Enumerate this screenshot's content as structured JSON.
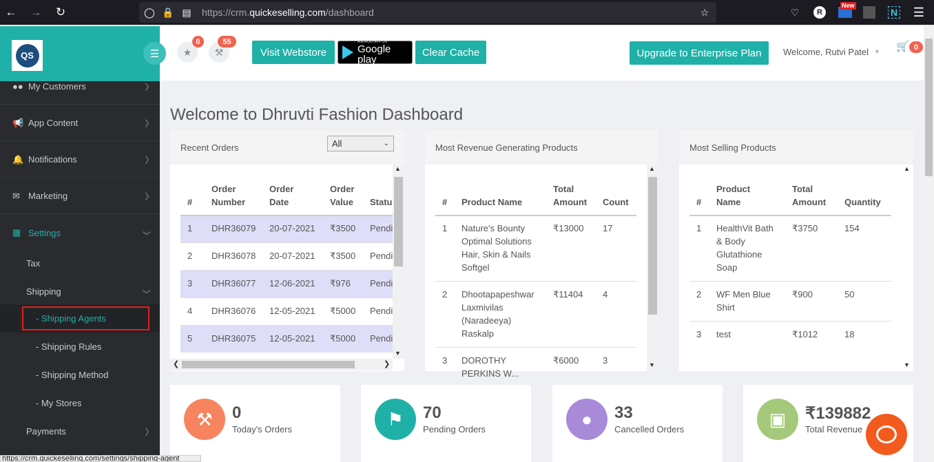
{
  "browser": {
    "url_prefix": "https://crm.",
    "url_domain": "quickeselling.com",
    "url_path": "/dashboard",
    "new_badge": "New",
    "profile_letter": "R",
    "ext_letter": "N"
  },
  "sidebar": {
    "logo_text": "QS",
    "items": [
      {
        "label": "My Customers",
        "icon": "users-icon"
      },
      {
        "label": "App Content",
        "icon": "bullhorn-icon"
      },
      {
        "label": "Notifications",
        "icon": "bell-icon"
      },
      {
        "label": "Marketing",
        "icon": "envelope-icon"
      },
      {
        "label": "Settings",
        "icon": "grid-icon"
      }
    ],
    "settings_sub": [
      "Tax",
      "Shipping"
    ],
    "shipping_sub": [
      "- Shipping Agents",
      "- Shipping Rules",
      "- Shipping Method",
      "- My Stores"
    ],
    "payments": "Payments",
    "active_color": "#1fb0a8",
    "highlight_color": "#e02020"
  },
  "header": {
    "star_badge": "0",
    "gavel_badge": "55",
    "visit_webstore": "Visit Webstore",
    "gplay_small": "ANDROID APP ON",
    "gplay_big": "Google play",
    "clear_cache": "Clear Cache",
    "upgrade": "Upgrade to Enterprise Plan",
    "welcome": "Welcome, Rutvi Patel",
    "cart_badge": "0"
  },
  "main": {
    "title": "Welcome to Dhruvti Fashion Dashboard"
  },
  "recent_orders": {
    "title": "Recent Orders",
    "filter_value": "All",
    "headers": [
      "#",
      "Order\nNumber",
      "Order\nDate",
      "Order\nValue",
      "Statu"
    ],
    "rows": [
      [
        "1",
        "DHR36079",
        "20-07-2021",
        "₹3500",
        "Pendi"
      ],
      [
        "2",
        "DHR36078",
        "20-07-2021",
        "₹3500",
        "Pendi"
      ],
      [
        "3",
        "DHR36077",
        "12-06-2021",
        "₹976",
        "Pendi"
      ],
      [
        "4",
        "DHR36076",
        "12-05-2021",
        "₹5000",
        "Pendi"
      ],
      [
        "5",
        "DHR36075",
        "12-05-2021",
        "₹5000",
        "Pendi"
      ]
    ]
  },
  "revenue_products": {
    "title": "Most Revenue Generating Products",
    "headers": [
      "#",
      "Product Name",
      "Total\nAmount",
      "Count"
    ],
    "rows": [
      [
        "1",
        "Nature's Bounty\nOptimal Solutions\nHair, Skin & Nails\nSoftgel",
        "₹13000",
        "17"
      ],
      [
        "2",
        "Dhootapapeshwar\nLaxmivilas\n(Naradeeya)\nRaskalp",
        "₹11404",
        "4"
      ],
      [
        "3",
        "DOROTHY\nPERKINS W...",
        "₹6000",
        "3"
      ]
    ]
  },
  "selling_products": {
    "title": "Most Selling Products",
    "headers": [
      "#",
      "Product\nName",
      "Total\nAmount",
      "Quantity"
    ],
    "rows": [
      [
        "1",
        "HealthVit Bath\n& Body\nGlutathione\nSoap",
        "₹3750",
        "154"
      ],
      [
        "2",
        "WF Men Blue\nShirt",
        "₹900",
        "50"
      ],
      [
        "3",
        "test",
        "₹1012",
        "18"
      ]
    ]
  },
  "stats": [
    {
      "value": "0",
      "label": "Today's Orders",
      "color": "#f7845e",
      "icon": "gavel-icon"
    },
    {
      "value": "70",
      "label": "Pending Orders",
      "color": "#1fb0a8",
      "icon": "tag-icon"
    },
    {
      "value": "33",
      "label": "Cancelled Orders",
      "color": "#a88ad8",
      "icon": "user-icon"
    },
    {
      "value": "₹139882",
      "label": "Total Revenue",
      "color": "#a5c97a",
      "icon": "money-icon"
    }
  ],
  "status_url": "https://crm.quickeselling.com/settings/shipping-agent"
}
